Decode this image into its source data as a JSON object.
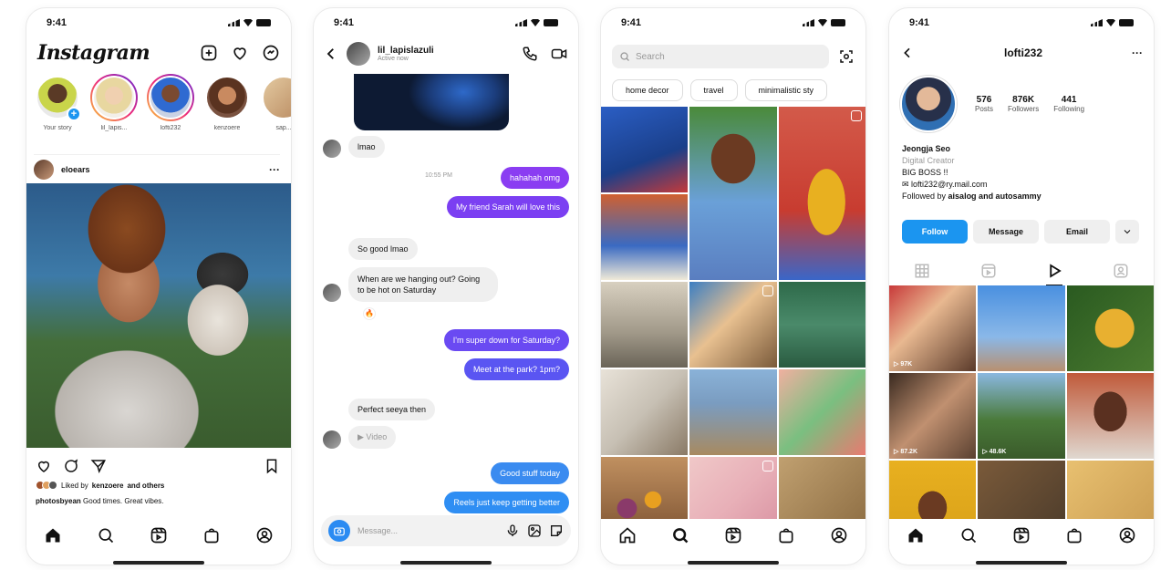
{
  "phone1": {
    "status_time": "9:41",
    "logo": "Instagram",
    "stories": [
      {
        "name": "Your story"
      },
      {
        "name": "lil_lapis..."
      },
      {
        "name": "lofti232"
      },
      {
        "name": "kenzoere"
      },
      {
        "name": "sap..."
      }
    ],
    "post_user": "eloears",
    "more": "···",
    "liked_prefix": "Liked by",
    "liked_user": "kenzoere",
    "liked_suffix": "and others",
    "caption_user": "photosbyean",
    "caption_text": "Good times. Great vibes."
  },
  "phone2": {
    "status_time": "9:41",
    "username": "lil_lapislazuli",
    "subtitle": "Active now",
    "messages": {
      "m1": "lmao",
      "time": "10:55 PM",
      "m2": "hahahah omg",
      "m3": "My friend Sarah will love this",
      "m4": "So good lmao",
      "m5": "When are we hanging out? Going to be hot on Saturday",
      "m5_reaction": "🔥",
      "m6": "I'm super down for Saturday?",
      "m7": "Meet at the park? 1pm?",
      "m8": "Perfect seeya then",
      "m9": "Video",
      "m10": "Good stuff today",
      "m11": "Reels just keep getting better"
    },
    "compose_placeholder": "Message..."
  },
  "phone3": {
    "status_time": "9:41",
    "search_placeholder": "Search",
    "chips": [
      "home decor",
      "travel",
      "minimalistic sty"
    ]
  },
  "phone4": {
    "status_time": "9:41",
    "username": "lofti232",
    "more": "···",
    "stats": [
      {
        "num": "576",
        "label": "Posts"
      },
      {
        "num": "876K",
        "label": "Followers"
      },
      {
        "num": "441",
        "label": "Following"
      }
    ],
    "name": "Jeongja Seo",
    "category": "Digital Creator",
    "bio_line": "BIG BOSS !!",
    "email_line": "✉ lofti232@ry.mail.com",
    "followed_prefix": "Followed by",
    "followed_names": "aisalog and autosammy",
    "btn_follow": "Follow",
    "btn_message": "Message",
    "btn_email": "Email",
    "views": [
      "▷ 97K",
      "▷ 87.2K",
      "▷ 48.6K"
    ]
  },
  "colors": {
    "accent_blue": "#1b95f0",
    "dm_purple": "#7b3ff2",
    "dm_blue": "#3a7bf0"
  }
}
